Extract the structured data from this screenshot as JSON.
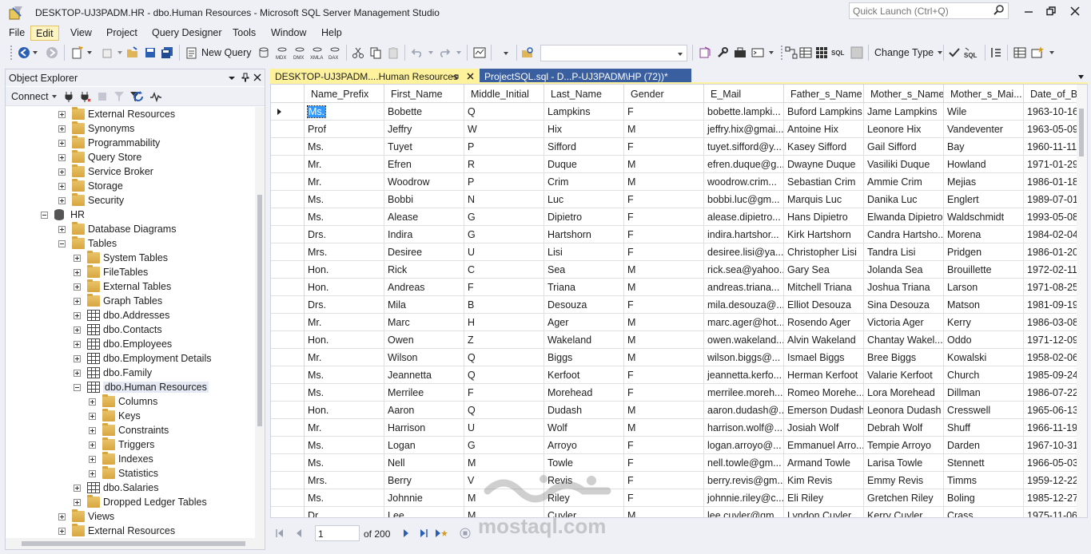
{
  "window": {
    "title": "DESKTOP-UJ3PADM.HR - dbo.Human Resources - Microsoft SQL Server Management Studio",
    "quick_launch_placeholder": "Quick Launch (Ctrl+Q)"
  },
  "menu": [
    "File",
    "Edit",
    "View",
    "Project",
    "Query Designer",
    "Tools",
    "Window",
    "Help"
  ],
  "menu_active": "Edit",
  "toolbar": {
    "new_query_label": "New Query",
    "change_type_label": "Change Type",
    "database_combo_value": ""
  },
  "object_explorer": {
    "title": "Object Explorer",
    "connect_label": "Connect",
    "tree": [
      {
        "label": "External Resources",
        "level": 2,
        "icon": "folder",
        "expander": "plus"
      },
      {
        "label": "Synonyms",
        "level": 2,
        "icon": "folder",
        "expander": "plus"
      },
      {
        "label": "Programmability",
        "level": 2,
        "icon": "folder",
        "expander": "plus"
      },
      {
        "label": "Query Store",
        "level": 2,
        "icon": "folder",
        "expander": "plus"
      },
      {
        "label": "Service Broker",
        "level": 2,
        "icon": "folder",
        "expander": "plus"
      },
      {
        "label": "Storage",
        "level": 2,
        "icon": "folder",
        "expander": "plus"
      },
      {
        "label": "Security",
        "level": 2,
        "icon": "folder",
        "expander": "plus"
      },
      {
        "label": "HR",
        "level": 1,
        "icon": "database",
        "expander": "minus"
      },
      {
        "label": "Database Diagrams",
        "level": 2,
        "icon": "folder",
        "expander": "plus"
      },
      {
        "label": "Tables",
        "level": 2,
        "icon": "folder",
        "expander": "minus"
      },
      {
        "label": "System Tables",
        "level": 3,
        "icon": "folder",
        "expander": "plus"
      },
      {
        "label": "FileTables",
        "level": 3,
        "icon": "folder",
        "expander": "plus"
      },
      {
        "label": "External Tables",
        "level": 3,
        "icon": "folder",
        "expander": "plus"
      },
      {
        "label": "Graph Tables",
        "level": 3,
        "icon": "folder",
        "expander": "plus"
      },
      {
        "label": "dbo.Addresses",
        "level": 3,
        "icon": "table",
        "expander": "plus"
      },
      {
        "label": "dbo.Contacts",
        "level": 3,
        "icon": "table",
        "expander": "plus"
      },
      {
        "label": "dbo.Employees",
        "level": 3,
        "icon": "table",
        "expander": "plus"
      },
      {
        "label": "dbo.Employment Details",
        "level": 3,
        "icon": "table",
        "expander": "plus"
      },
      {
        "label": "dbo.Family",
        "level": 3,
        "icon": "table",
        "expander": "plus"
      },
      {
        "label": "dbo.Human Resources",
        "level": 3,
        "icon": "table",
        "expander": "minus",
        "selected": true
      },
      {
        "label": "Columns",
        "level": 4,
        "icon": "folder",
        "expander": "plus"
      },
      {
        "label": "Keys",
        "level": 4,
        "icon": "folder",
        "expander": "plus"
      },
      {
        "label": "Constraints",
        "level": 4,
        "icon": "folder",
        "expander": "plus"
      },
      {
        "label": "Triggers",
        "level": 4,
        "icon": "folder",
        "expander": "plus"
      },
      {
        "label": "Indexes",
        "level": 4,
        "icon": "folder",
        "expander": "plus"
      },
      {
        "label": "Statistics",
        "level": 4,
        "icon": "folder",
        "expander": "plus"
      },
      {
        "label": "dbo.Salaries",
        "level": 3,
        "icon": "table",
        "expander": "plus"
      },
      {
        "label": "Dropped Ledger Tables",
        "level": 3,
        "icon": "folder",
        "expander": "plus"
      },
      {
        "label": "Views",
        "level": 2,
        "icon": "folder",
        "expander": "plus"
      },
      {
        "label": "External Resources",
        "level": 2,
        "icon": "folder",
        "expander": "plus"
      }
    ]
  },
  "tabs": [
    {
      "label": "DESKTOP-UJ3PADM....Human Resources",
      "active": true
    },
    {
      "label": "ProjectSQL.sql - D...P-UJ3PADM\\HP (72))*",
      "active": false
    }
  ],
  "grid": {
    "columns": [
      "Name_Prefix",
      "First_Name",
      "Middle_Initial",
      "Last_Name",
      "Gender",
      "E_Mail",
      "Father_s_Name",
      "Mother_s_Name",
      "Mother_s_Mai...",
      "Date_of_Bi"
    ],
    "rows": [
      [
        "Ms.",
        "Bobette",
        "Q",
        "Lampkins",
        "F",
        "bobette.lampki...",
        "Buford Lampkins",
        "Jame Lampkins",
        "Wile",
        "1963-10-16"
      ],
      [
        "Prof",
        "Jeffry",
        "W",
        "Hix",
        "M",
        "jeffry.hix@gmai...",
        "Antoine Hix",
        "Leonore Hix",
        "Vandeventer",
        "1963-05-09"
      ],
      [
        "Ms.",
        "Tuyet",
        "P",
        "Sifford",
        "F",
        "tuyet.sifford@y...",
        "Kasey Sifford",
        "Gail Sifford",
        "Bay",
        "1960-11-11"
      ],
      [
        "Mr.",
        "Efren",
        "R",
        "Duque",
        "M",
        "efren.duque@g...",
        "Dwayne Duque",
        "Vasiliki Duque",
        "Howland",
        "1971-01-29"
      ],
      [
        "Mr.",
        "Woodrow",
        "P",
        "Crim",
        "M",
        "woodrow.crim...",
        "Sebastian Crim",
        "Ammie Crim",
        "Mejias",
        "1986-01-18"
      ],
      [
        "Ms.",
        "Bobbi",
        "N",
        "Luc",
        "F",
        "bobbi.luc@gm...",
        "Marquis Luc",
        "Danika Luc",
        "Englert",
        "1989-07-01"
      ],
      [
        "Ms.",
        "Alease",
        "G",
        "Dipietro",
        "F",
        "alease.dipietro...",
        "Hans Dipietro",
        "Elwanda Dipietro",
        "Waldschmidt",
        "1993-05-08"
      ],
      [
        "Drs.",
        "Indira",
        "G",
        "Hartshorn",
        "F",
        "indira.hartshor...",
        "Kirk Hartshorn",
        "Candra Hartsho...",
        "Morena",
        "1984-02-04"
      ],
      [
        "Mrs.",
        "Desiree",
        "U",
        "Lisi",
        "F",
        "desiree.lisi@ya...",
        "Christopher Lisi",
        "Tandra Lisi",
        "Pridgen",
        "1986-01-20"
      ],
      [
        "Hon.",
        "Rick",
        "C",
        "Sea",
        "M",
        "rick.sea@yahoo...",
        "Gary Sea",
        "Jolanda Sea",
        "Brouillette",
        "1972-02-11"
      ],
      [
        "Hon.",
        "Andreas",
        "F",
        "Triana",
        "M",
        "andreas.triana...",
        "Mitchell Triana",
        "Joshua Triana",
        "Larson",
        "1971-08-25"
      ],
      [
        "Drs.",
        "Mila",
        "B",
        "Desouza",
        "F",
        "mila.desouza@...",
        "Elliot Desouza",
        "Sina Desouza",
        "Matson",
        "1981-09-19"
      ],
      [
        "Mr.",
        "Marc",
        "H",
        "Ager",
        "M",
        "marc.ager@hot...",
        "Rosendo Ager",
        "Victoria Ager",
        "Kerry",
        "1986-03-08"
      ],
      [
        "Hon.",
        "Owen",
        "Z",
        "Wakeland",
        "M",
        "owen.wakeland...",
        "Alvin Wakeland",
        "Chantay Wakel...",
        "Oddo",
        "1971-12-09"
      ],
      [
        "Mr.",
        "Wilson",
        "Q",
        "Biggs",
        "M",
        "wilson.biggs@...",
        "Ismael Biggs",
        "Bree Biggs",
        "Kowalski",
        "1958-02-06"
      ],
      [
        "Ms.",
        "Jeannetta",
        "Q",
        "Kerfoot",
        "F",
        "jeannetta.kerfo...",
        "Herman Kerfoot",
        "Valarie Kerfoot",
        "Church",
        "1985-09-24"
      ],
      [
        "Ms.",
        "Merrilee",
        "F",
        "Morehead",
        "F",
        "merrilee.moreh...",
        "Romeo Morehe...",
        "Lora Morehead",
        "Dillman",
        "1986-07-22"
      ],
      [
        "Hon.",
        "Aaron",
        "Q",
        "Dudash",
        "M",
        "aaron.dudash@...",
        "Emerson Dudash",
        "Leonora Dudash",
        "Cresswell",
        "1965-06-13"
      ],
      [
        "Mr.",
        "Harrison",
        "U",
        "Wolf",
        "M",
        "harrison.wolf@...",
        "Josiah Wolf",
        "Debrah Wolf",
        "Shuff",
        "1966-11-19"
      ],
      [
        "Ms.",
        "Logan",
        "G",
        "Arroyo",
        "F",
        "logan.arroyo@...",
        "Emmanuel Arro...",
        "Tempie Arroyo",
        "Darden",
        "1967-10-31"
      ],
      [
        "Ms.",
        "Nell",
        "M",
        "Towle",
        "F",
        "nell.towle@gm...",
        "Armand Towle",
        "Larisa Towle",
        "Stennett",
        "1966-05-03"
      ],
      [
        "Mrs.",
        "Berry",
        "V",
        "Revis",
        "F",
        "berry.revis@gm...",
        "Kim Revis",
        "Emmy Revis",
        "Timms",
        "1959-12-22"
      ],
      [
        "Ms.",
        "Johnnie",
        "M",
        "Riley",
        "F",
        "johnnie.riley@c...",
        "Eli Riley",
        "Gretchen Riley",
        "Boling",
        "1985-12-27"
      ],
      [
        "Dr.",
        "Lee",
        "M",
        "Cuyler",
        "M",
        "lee.cuyler@gm...",
        "Lyndon Cuyler",
        "Kerry Cuyler",
        "Crass",
        "1975-11-06"
      ]
    ]
  },
  "navigation": {
    "current_page": "1",
    "of_label": "of 200"
  },
  "watermark": {
    "arabic": "مستقل",
    "latin": "mostaql.com"
  },
  "colors": {
    "active_tab": "#fff29d",
    "inactive_tab": "#3a5fa0",
    "selection": "#3399ff",
    "menu_active": "#fdf4bf"
  }
}
